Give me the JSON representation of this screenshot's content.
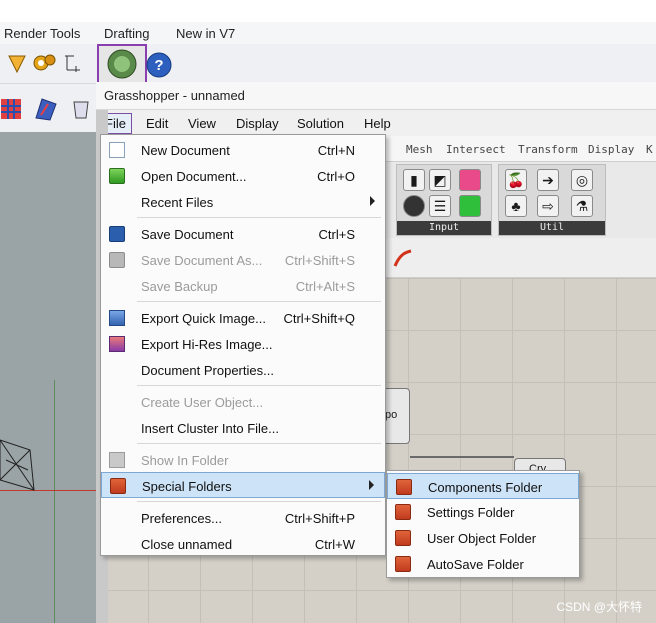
{
  "rhino": {
    "menubar": [
      "Render Tools",
      "Drafting",
      "New in V7"
    ]
  },
  "grasshopper": {
    "title": "Grasshopper - unnamed",
    "menubar": [
      "File",
      "Edit",
      "View",
      "Display",
      "Solution",
      "Help"
    ],
    "tabs": [
      "Mesh",
      "Intersect",
      "Transform",
      "Display",
      "K"
    ],
    "ribbon_groups": [
      "Input",
      "Util"
    ]
  },
  "canvas": {
    "node1_label": "po",
    "node2_label": "Crv"
  },
  "file_menu": {
    "items": [
      {
        "label": "New Document",
        "shortcut": "Ctrl+N"
      },
      {
        "label": "Open Document...",
        "shortcut": "Ctrl+O"
      },
      {
        "label": "Recent Files",
        "shortcut": ""
      },
      {
        "label": "Save Document",
        "shortcut": "Ctrl+S"
      },
      {
        "label": "Save Document As...",
        "shortcut": "Ctrl+Shift+S"
      },
      {
        "label": "Save Backup",
        "shortcut": "Ctrl+Alt+S"
      },
      {
        "label": "Export Quick Image...",
        "shortcut": "Ctrl+Shift+Q"
      },
      {
        "label": "Export Hi-Res Image...",
        "shortcut": ""
      },
      {
        "label": "Document Properties...",
        "shortcut": ""
      },
      {
        "label": "Create User Object...",
        "shortcut": ""
      },
      {
        "label": "Insert Cluster Into File...",
        "shortcut": ""
      },
      {
        "label": "Show In Folder",
        "shortcut": ""
      },
      {
        "label": "Special Folders",
        "shortcut": ""
      },
      {
        "label": "Preferences...",
        "shortcut": "Ctrl+Shift+P"
      },
      {
        "label": "Close unnamed",
        "shortcut": "Ctrl+W"
      }
    ]
  },
  "special_folders_menu": {
    "items": [
      "Components Folder",
      "Settings Folder",
      "User Object Folder",
      "AutoSave Folder"
    ]
  },
  "watermark": "CSDN @大怀特"
}
